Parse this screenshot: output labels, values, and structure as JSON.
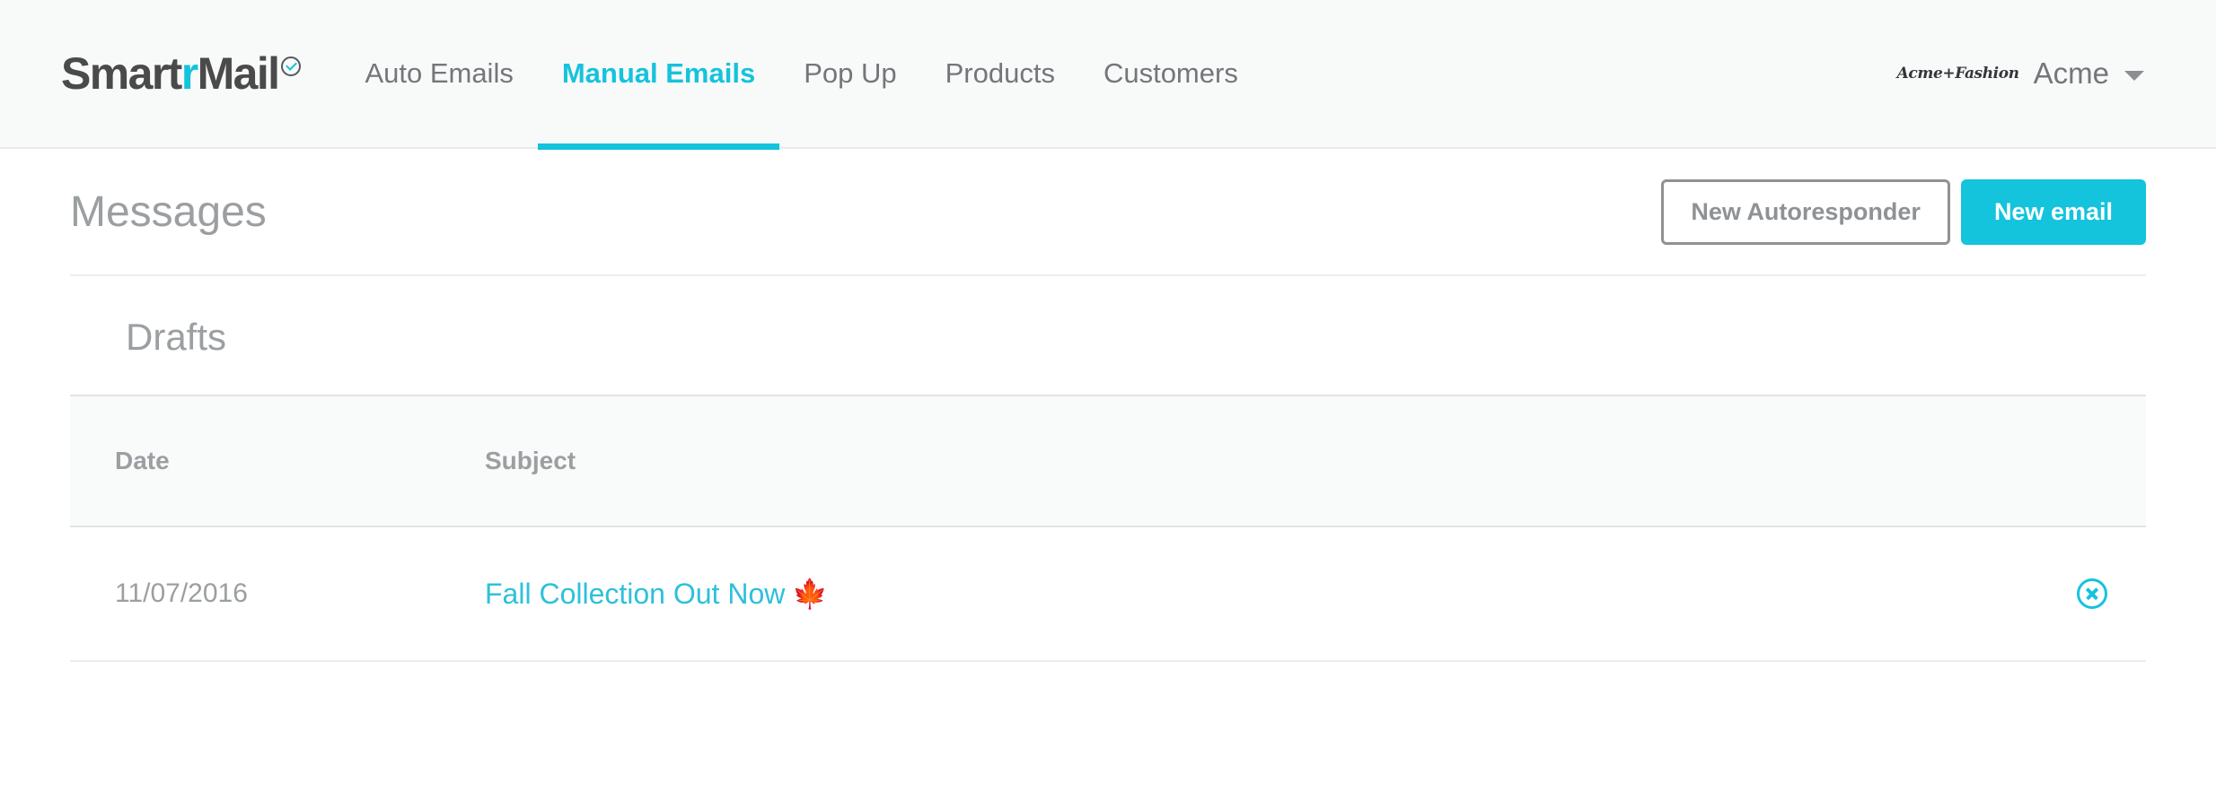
{
  "brand": {
    "name_part1": "Smart",
    "name_accent": "r",
    "name_part2": "Mail",
    "mark_icon": "check-circle-icon"
  },
  "nav": {
    "items": [
      {
        "label": "Auto Emails",
        "active": false
      },
      {
        "label": "Manual Emails",
        "active": true
      },
      {
        "label": "Pop Up",
        "active": false
      },
      {
        "label": "Products",
        "active": false
      },
      {
        "label": "Customers",
        "active": false
      }
    ]
  },
  "account": {
    "logo_text": "Acme+Fashion",
    "name": "Acme",
    "caret_icon": "chevron-down-icon"
  },
  "page": {
    "title": "Messages",
    "new_autoresponder_label": "New Autoresponder",
    "new_email_label": "New email"
  },
  "drafts": {
    "section_title": "Drafts",
    "columns": [
      "Date",
      "Subject"
    ],
    "rows": [
      {
        "date": "11/07/2016",
        "subject": "Fall Collection Out Now",
        "subject_emoji": "🍁",
        "delete_icon": "delete-circle-icon"
      }
    ]
  },
  "colors": {
    "accent": "#14c3dc",
    "text_muted": "#9b9fa1",
    "nav_text": "#73777a",
    "header_bg": "#f8f9f9",
    "table_header_bg": "#f9fafa"
  }
}
